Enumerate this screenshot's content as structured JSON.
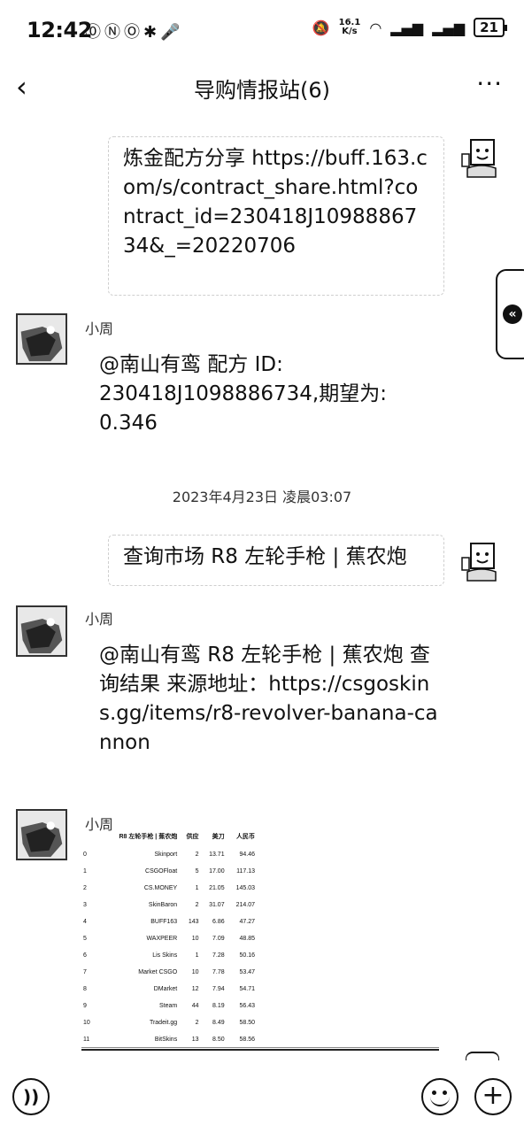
{
  "status_bar": {
    "time": "12:42",
    "left_icons": "⓪ⓃⓄ✱🎤",
    "net_speed_top": "16.1",
    "net_speed_bottom": "K/s",
    "battery": "21"
  },
  "nav": {
    "title": "导购情报站(6)",
    "back_icon": "‹",
    "more_icon": "···"
  },
  "messages": {
    "sent1_text": "炼金配方分享 https://buff.163.com/s/contract_share.html?contract_id=230418J1098886734&_=20220706",
    "recv1_sender": "小周",
    "recv1_text": "@南山有鸾 配方 ID: 230418J1098886734,期望为: 0.346",
    "timestamp": "2023年4月23日 凌晨03:07",
    "sent2_text": "查询市场 R8 左轮手枪 | 蕉农炮",
    "recv2_sender": "小周",
    "recv2_text": "@南山有鸾 R8 左轮手枪 | 蕉农炮 查询结果 来源地址：https://csgoskins.gg/items/r8-revolver-banana-cannon",
    "recv3_sender": "小周"
  },
  "table": {
    "headers": [
      "",
      "R8 左轮手枪 | 蕉农炮",
      "供应",
      "美刀",
      "人民币"
    ],
    "rows": [
      [
        "0",
        "Skinport",
        "2",
        "13.71",
        "94.46"
      ],
      [
        "1",
        "CSGOFloat",
        "5",
        "17.00",
        "117.13"
      ],
      [
        "2",
        "CS.MONEY",
        "1",
        "21.05",
        "145.03"
      ],
      [
        "3",
        "SkinBaron",
        "2",
        "31.07",
        "214.07"
      ],
      [
        "4",
        "BUFF163",
        "143",
        "6.86",
        "47.27"
      ],
      [
        "5",
        "WAXPEER",
        "10",
        "7.09",
        "48.85"
      ],
      [
        "6",
        "Lis Skins",
        "1",
        "7.28",
        "50.16"
      ],
      [
        "7",
        "Market CSGO",
        "10",
        "7.78",
        "53.47"
      ],
      [
        "8",
        "DMarket",
        "12",
        "7.94",
        "54.71"
      ],
      [
        "9",
        "Steam",
        "44",
        "8.19",
        "56.43"
      ],
      [
        "10",
        "Tradeit.gg",
        "2",
        "8.49",
        "58.50"
      ],
      [
        "11",
        "BitSkins",
        "13",
        "8.50",
        "58.56"
      ]
    ]
  },
  "bottom_bar": {
    "voice_icon": "))",
    "plus_icon": "+"
  },
  "side_tab_icon": "«"
}
